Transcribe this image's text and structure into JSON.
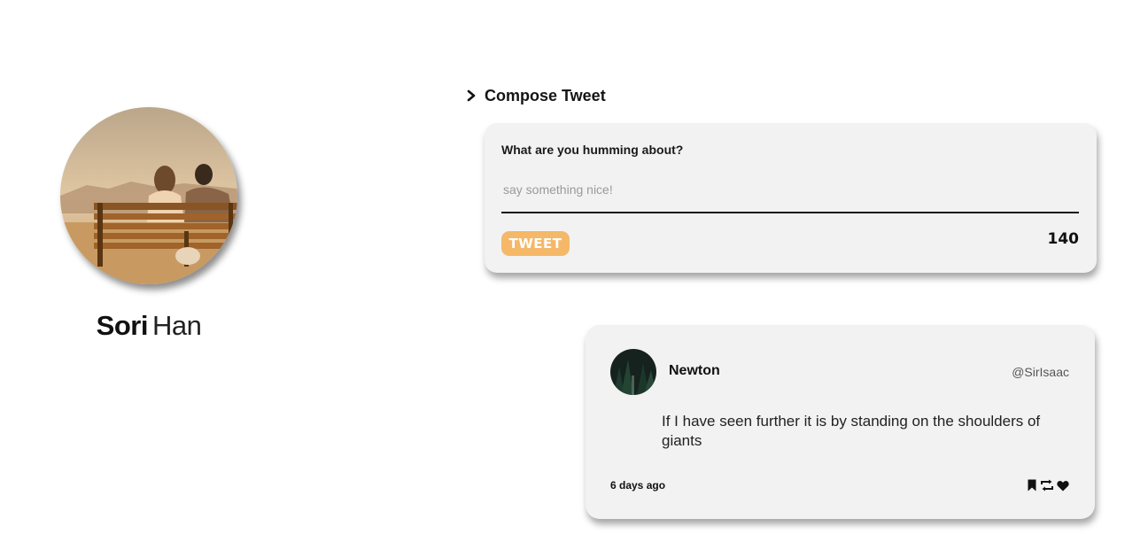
{
  "profile": {
    "first_name": "Sori",
    "last_name": "Han",
    "avatar_icon": "profile-photo-couple-on-bench"
  },
  "compose": {
    "header_label": "Compose Tweet",
    "header_icon": "chevron-right-icon",
    "prompt": "What are you humming about?",
    "input_placeholder": "say something nice!",
    "input_value": "",
    "tweet_button_label": "TWEET",
    "char_count": "140"
  },
  "tweet": {
    "author_name": "Newton",
    "handle": "@SirIsaac",
    "text": "If I have seen further it is by standing on the shoulders of giants",
    "timestamp": "6 days ago",
    "actions": [
      "bookmark-icon",
      "retweet-icon",
      "heart-icon"
    ]
  },
  "colors": {
    "accent": "#f5b868",
    "card_background": "#f2f2f2",
    "page_background": "#ffffff"
  }
}
